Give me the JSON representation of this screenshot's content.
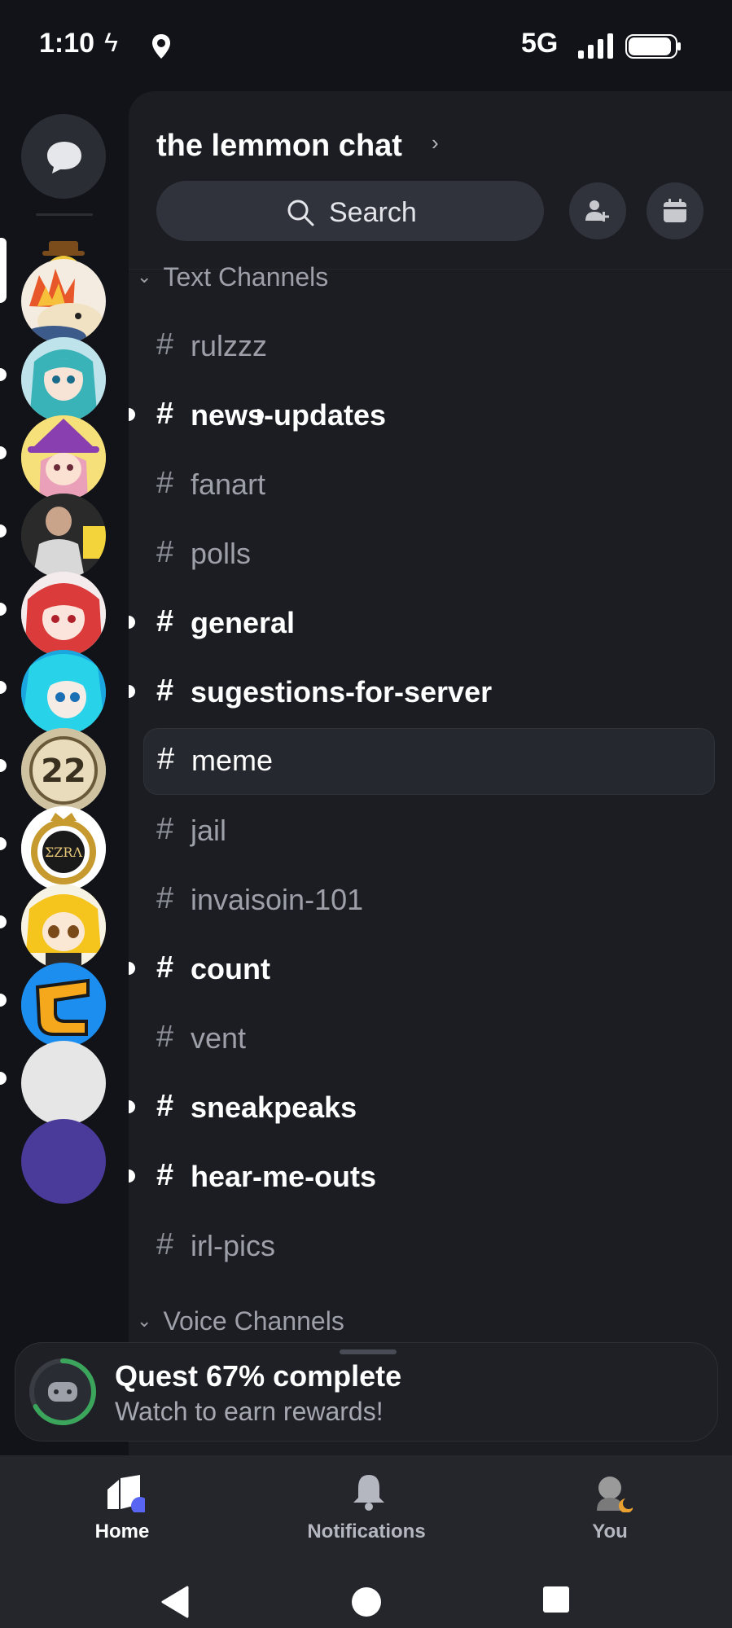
{
  "status_bar": {
    "time": "1:10",
    "network": "5G"
  },
  "server": {
    "name": "the lemmon chat",
    "search_label": "Search",
    "sections": [
      {
        "label": "Text Channels"
      },
      {
        "label": "Voice Channels"
      }
    ],
    "channels": [
      {
        "name": "rulzzz",
        "unread": false,
        "selected": false
      },
      {
        "name": "news-updates",
        "unread": true,
        "selected": false
      },
      {
        "name": "fanart",
        "unread": false,
        "selected": false
      },
      {
        "name": "polls",
        "unread": false,
        "selected": false
      },
      {
        "name": "general",
        "unread": true,
        "selected": false
      },
      {
        "name": "sugestions-for-server",
        "unread": true,
        "selected": false
      },
      {
        "name": "meme",
        "unread": false,
        "selected": true
      },
      {
        "name": "jail",
        "unread": false,
        "selected": false
      },
      {
        "name": "invaisoin-101",
        "unread": false,
        "selected": false
      },
      {
        "name": "count",
        "unread": true,
        "selected": false
      },
      {
        "name": "vent",
        "unread": false,
        "selected": false
      },
      {
        "name": "sneakpeaks",
        "unread": true,
        "selected": false
      },
      {
        "name": "hear-me-outs",
        "unread": true,
        "selected": false
      },
      {
        "name": "irl-pics",
        "unread": false,
        "selected": false
      }
    ],
    "hash": "#"
  },
  "server_rail": [
    {
      "icon": "lemon-mustache-avatar",
      "color": "#e8c84a"
    },
    {
      "icon": "fire-creature-avatar",
      "color": "#f0e8d8"
    },
    {
      "icon": "teal-anime-avatar",
      "color": "#6fb7c4"
    },
    {
      "icon": "witch-anime-avatar",
      "color": "#d36ab0"
    },
    {
      "icon": "man-photo-avatar",
      "color": "#5a5a5a"
    },
    {
      "icon": "red-hair-anime-avatar",
      "color": "#e05a5a"
    },
    {
      "icon": "blue-anime-avatar",
      "color": "#2ab6e6"
    },
    {
      "icon": "22-badge-avatar",
      "color": "#c9b98f"
    },
    {
      "icon": "gold-crest-avatar",
      "color": "#b8902a"
    },
    {
      "icon": "yellow-anime-avatar",
      "color": "#f2c531"
    },
    {
      "icon": "c-logo-avatar",
      "color": "#1a8ff0"
    }
  ],
  "quest": {
    "title": "Quest 67% complete",
    "subtitle": "Watch to earn rewards!",
    "progress": 0.67
  },
  "bottom_nav": [
    {
      "label": "Home",
      "icon": "home-icon"
    },
    {
      "label": "Notifications",
      "icon": "bell-icon"
    },
    {
      "label": "You",
      "icon": "profile-icon"
    }
  ],
  "colors": {
    "accent": "#5865f2",
    "quest_ring": "#3ba55c",
    "panel": "#1b1d23"
  }
}
